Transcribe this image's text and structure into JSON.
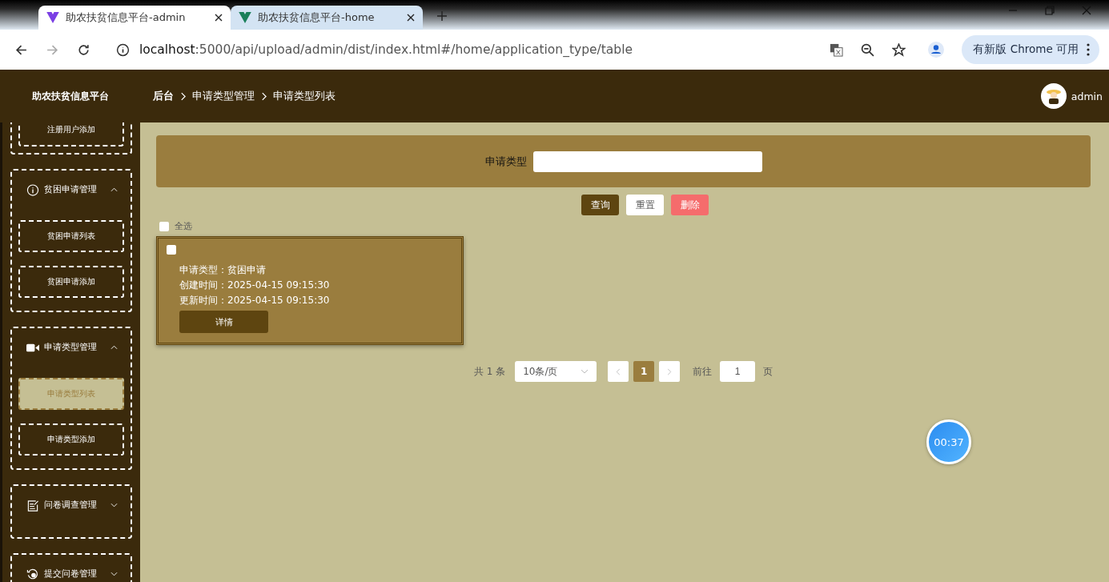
{
  "browser": {
    "tabs": [
      {
        "title": "助农扶贫信息平台-admin",
        "selected": true,
        "color": "#7b3fe4"
      },
      {
        "title": "助农扶贫信息平台-home",
        "selected": false,
        "color": "#1a7f5a"
      }
    ],
    "url_host": "localhost",
    "url_path": ":5000/api/upload/admin/dist/index.html#/home/application_type/table",
    "update_label": "有新版 Chrome 可用"
  },
  "app": {
    "logo": "助农扶贫信息平台",
    "breadcrumb": [
      {
        "label": "后台",
        "bold": true
      },
      {
        "label": "申请类型管理",
        "bold": false
      },
      {
        "label": "申请类型列表",
        "bold": false
      }
    ],
    "user": "admin"
  },
  "sidebar": {
    "groups": [
      {
        "kind": "partial",
        "children": [
          {
            "label": "注册用户添加",
            "selected": false
          }
        ]
      },
      {
        "kind": "full",
        "title": "贫困申请管理",
        "expanded": true,
        "children": [
          {
            "label": "贫困申请列表",
            "selected": false
          },
          {
            "label": "贫困申请添加",
            "selected": false
          }
        ]
      },
      {
        "kind": "full",
        "title": "申请类型管理",
        "expanded": true,
        "children": [
          {
            "label": "申请类型列表",
            "selected": true
          },
          {
            "label": "申请类型添加",
            "selected": false
          }
        ]
      },
      {
        "kind": "full",
        "title": "问卷调查管理",
        "expanded": false
      },
      {
        "kind": "full",
        "title": "提交问卷管理",
        "expanded": false
      }
    ]
  },
  "search": {
    "label": "申请类型"
  },
  "actions": [
    {
      "label": "查询",
      "kind": "primary"
    },
    {
      "label": "重置",
      "kind": "plain"
    },
    {
      "label": "删除",
      "kind": "danger"
    }
  ],
  "select_all": {
    "label": "全选",
    "checked": false
  },
  "cards": [
    {
      "checked": false,
      "fields": [
        "申请类型：贫困申请",
        "创建时间：2025-04-15 09:15:30",
        "更新时间：2025-04-15 09:15:30"
      ],
      "button": "详情"
    }
  ],
  "pagination": {
    "total": "共 1 条",
    "page_size": "10条/页",
    "pages": [
      {
        "label": "1",
        "selected": true
      }
    ],
    "goto_label": "前往",
    "goto_value": "1",
    "page_suffix": "页"
  },
  "timer": "00:37"
}
